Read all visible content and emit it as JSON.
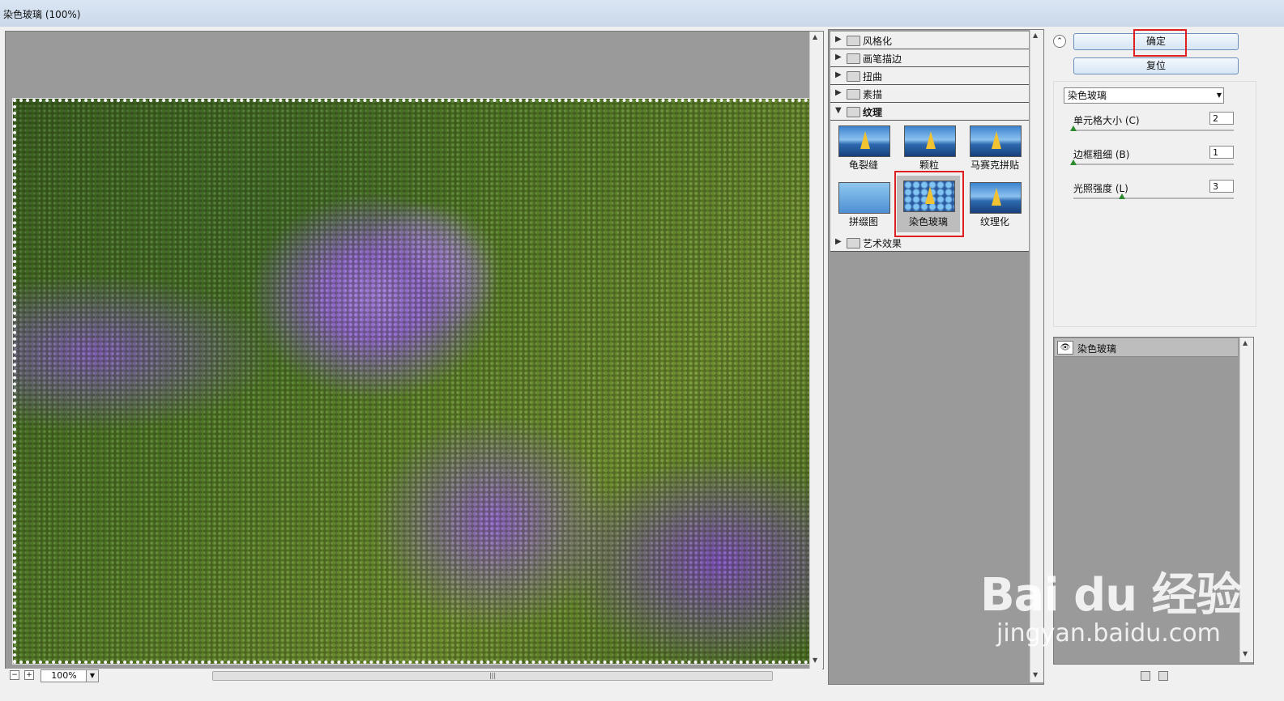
{
  "window": {
    "title": "染色玻璃 (100%)"
  },
  "preview": {
    "zoom": "100%",
    "zoom_out": "−",
    "zoom_in": "+"
  },
  "gallery": {
    "categories": [
      {
        "label": "风格化"
      },
      {
        "label": "画笔描边"
      },
      {
        "label": "扭曲"
      },
      {
        "label": "素描"
      },
      {
        "label": "纹理"
      },
      {
        "label": "艺术效果"
      }
    ],
    "texture_filters": [
      "龟裂缝",
      "颗粒",
      "马赛克拼贴",
      "拼缀图",
      "染色玻璃",
      "纹理化"
    ],
    "selected_filter": "染色玻璃"
  },
  "buttons": {
    "ok": "确定",
    "reset": "复位"
  },
  "filter_select": {
    "value": "染色玻璃"
  },
  "params": [
    {
      "label": "单元格大小 (C)",
      "value": "2",
      "level": 0.0
    },
    {
      "label": "边框粗细 (B)",
      "value": "1",
      "level": 0.0
    },
    {
      "label": "光照强度 (L)",
      "value": "3",
      "level": 0.3
    }
  ],
  "layers": [
    {
      "name": "染色玻璃",
      "visible": true
    }
  ],
  "watermark": {
    "logo": "Bai du 经验",
    "url": "jingyan.baidu.com"
  }
}
